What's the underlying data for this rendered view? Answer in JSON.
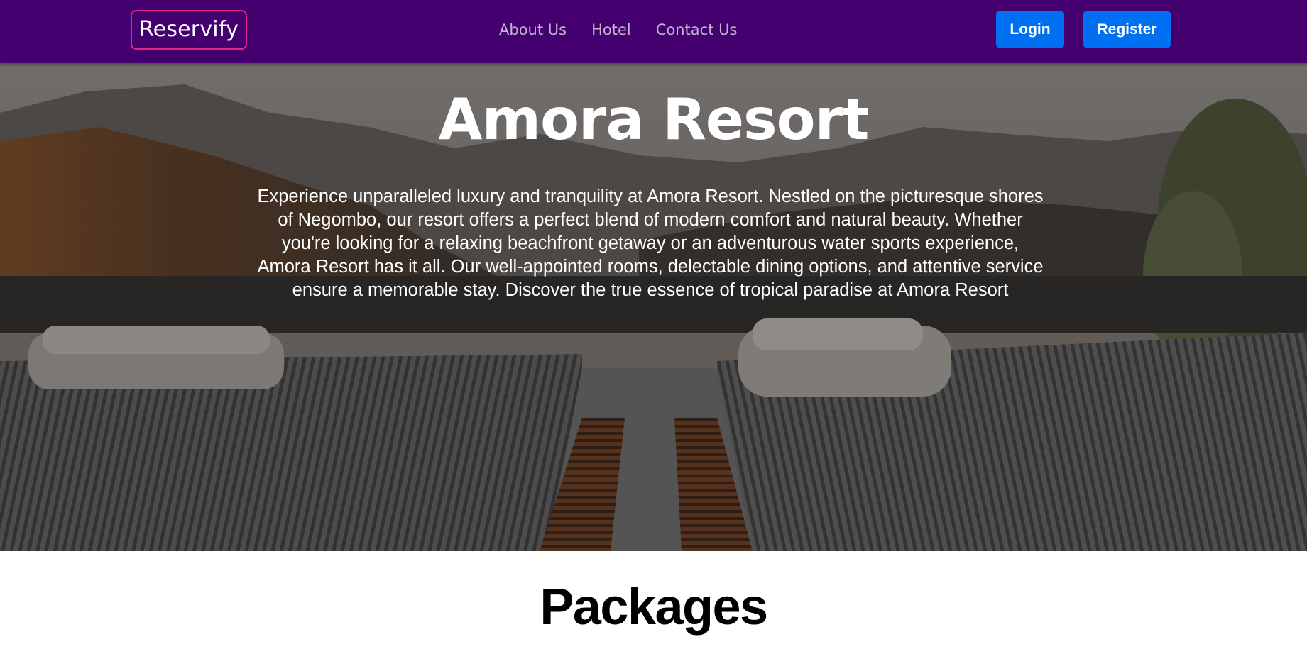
{
  "navbar": {
    "brand": "Reservify",
    "links": [
      "About Us",
      "Hotel",
      "Contact Us"
    ],
    "login_label": "Login",
    "register_label": "Register"
  },
  "hero": {
    "title": "Amora Resort",
    "description": "Experience unparalleled luxury and tranquility at Amora Resort. Nestled on the picturesque shores of Negombo, our resort offers a perfect blend of modern comfort and natural beauty. Whether you're looking for a relaxing beachfront getaway or an adventurous water sports experience, Amora Resort has it all. Our well-appointed rooms, delectable dining options, and attentive service ensure a memorable stay. Discover the true essence of tropical paradise at Amora Resort",
    "background_image": "resort-lounge-chairs-with-towels"
  },
  "packages": {
    "title": "Packages"
  },
  "colors": {
    "navbar_bg": "#44006f",
    "brand_border": "#e0248c",
    "nav_link": "#c3b4cf",
    "button_bg": "#0070f3"
  }
}
